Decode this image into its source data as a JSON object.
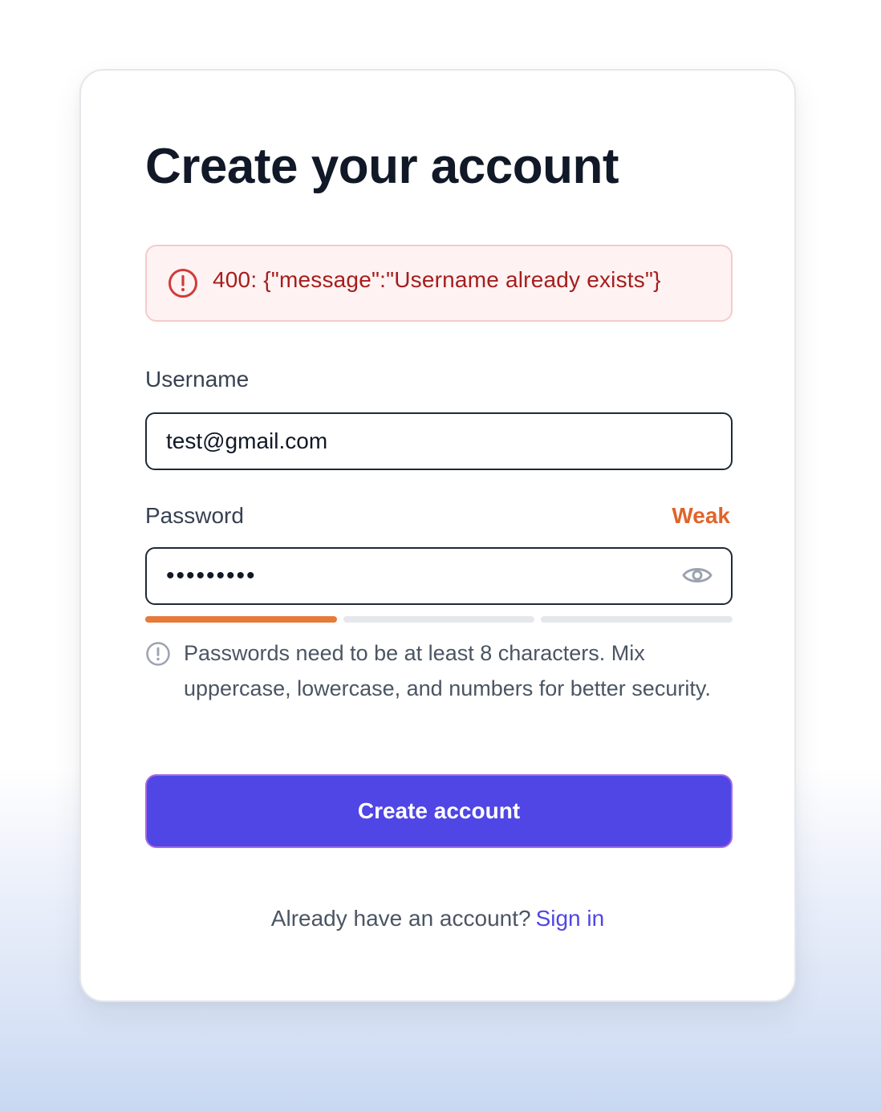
{
  "form": {
    "title": "Create your account",
    "error": {
      "icon": "alert-circle-icon",
      "message": "400: {\"message\":\"Username already exists\"}"
    },
    "username": {
      "label": "Username",
      "value": "test@gmail.com"
    },
    "password": {
      "label": "Password",
      "value": "123456789",
      "strength_label": "Weak",
      "strength_level": 1,
      "strength_segments": 3,
      "toggle_icon": "eye-icon",
      "hint_icon": "info-circle-icon",
      "hint": "Passwords need to be at least 8 characters. Mix uppercase, lowercase, and numbers for better security."
    },
    "submit_label": "Create account",
    "footer": {
      "prompt": "Already have an account?",
      "link_label": "Sign in"
    }
  },
  "colors": {
    "accent": "#4f46e5",
    "error_text": "#a61d1d",
    "error_bg": "#fef2f2",
    "strength_weak": "#e0642a",
    "heading": "#111827"
  }
}
